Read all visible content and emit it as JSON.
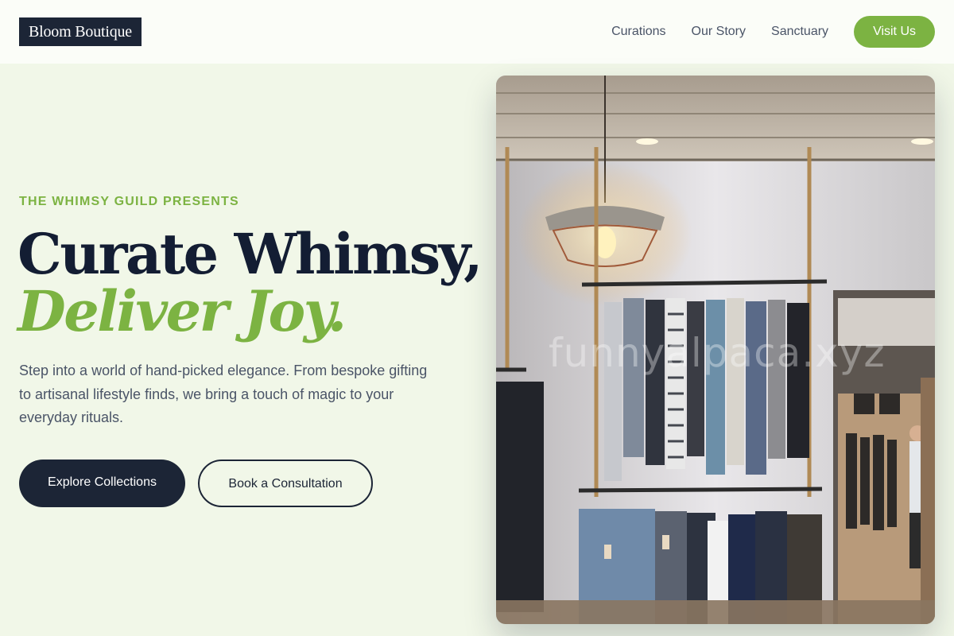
{
  "header": {
    "logo": "Bloom Boutique",
    "nav": [
      "Curations",
      "Our Story",
      "Sanctuary"
    ],
    "cta": "Visit Us"
  },
  "hero": {
    "eyebrow": "THE WHIMSY GUILD PRESENTS",
    "title_line1": "Curate Whimsy,",
    "title_line2": "Deliver Joy.",
    "description": "Step into a world of hand-picked elegance. From bespoke gifting to artisanal lifestyle finds, we bring a touch of magic to your everyday rituals.",
    "primary_button": "Explore Collections",
    "secondary_button": "Book a Consultation"
  },
  "photo": {
    "watermark": "funnyalpaca.xyz"
  },
  "colors": {
    "accent": "#7cb342",
    "dark": "#1c2536",
    "background": "#f1f7e8"
  }
}
